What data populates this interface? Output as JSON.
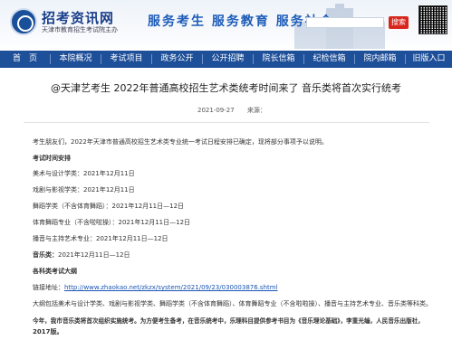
{
  "header": {
    "site_name": "招考资讯网",
    "site_subtitle": "天津市教育招生考试院主办",
    "slogan": "服务考生  服务教育  服务社会",
    "search_button": "搜索",
    "qr_label": ""
  },
  "nav": {
    "items": [
      "首　页",
      "本院概况",
      "考试项目",
      "政务公开",
      "公开招聘",
      "院长信箱",
      "纪检信箱",
      "院内邮箱",
      "旧版入口"
    ]
  },
  "article": {
    "title": "@天津艺考生 2022年普通高校招生艺术类统考时间来了 音乐类将首次实行统考",
    "date": "2021-09-27",
    "source_label": "来源：",
    "intro": "考生朋友们，2022年天津市普通高校招生艺术类专业统一考试日程安排已确定，现将部分事项予以说明。",
    "schedule_heading": "考试时间安排",
    "schedule": [
      "美术与设计学类：2021年12月11日",
      "戏剧与影视学类：2021年12月11日",
      "舞蹈学类（不含体育舞蹈）：2021年12月11日—12日",
      "体育舞蹈专业（不含啦啦操）：2021年12月11日—12日",
      "播音与主持艺术专业：2021年12月11日—12日"
    ],
    "music_label": "音乐类：",
    "music_date": "2021年12月11日—12日",
    "syllabus_heading": "各科类考试大纲",
    "link_label": "链接地址：",
    "link_url": "http://www.zhaokao.net/zkzx/system/2021/09/23/030003876.shtml",
    "syllabus_text": "大纲包括美术与设计学类、戏剧与影视学类、舞蹈学类（不含体育舞蹈）、体育舞蹈专业（不含啦啦操）、播音与主持艺术专业、音乐类等科类。",
    "notice_line1": "今年，我市音乐类将首次组织实施统考。为方便考生备考，在音乐统考中，乐理科目提供参考书目为《音乐理论基础》，李重光编，人民音乐出版社，",
    "notice_line2": "2017版。"
  },
  "colors": {
    "nav_bg": "#1e4f99",
    "slogan": "#1d5cb8",
    "search_button": "#d7261b"
  }
}
